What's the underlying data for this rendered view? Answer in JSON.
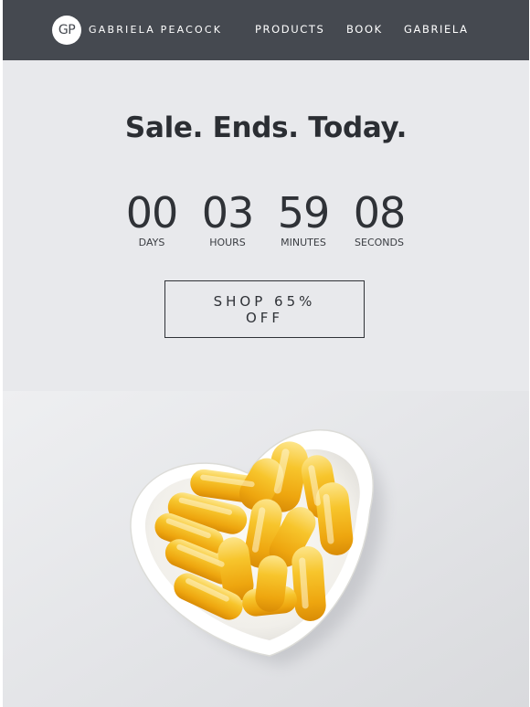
{
  "header": {
    "logo_monogram": "GP",
    "brand_name": "GABRIELA PEACOCK",
    "nav": [
      {
        "label": "PRODUCTS"
      },
      {
        "label": "BOOK"
      },
      {
        "label": "GABRIELA"
      }
    ]
  },
  "main": {
    "headline": "Sale. Ends. Today.",
    "countdown": [
      {
        "value": "00",
        "unit": "DAYS"
      },
      {
        "value": "03",
        "unit": "HOURS"
      },
      {
        "value": "59",
        "unit": "MINUTES"
      },
      {
        "value": "08",
        "unit": "SECONDS"
      }
    ],
    "cta_label": "SHOP 65% OFF"
  },
  "hero": {
    "image": "heart-shaped-bowl-of-fish-oil-capsules"
  },
  "colors": {
    "header_bg": "#454950",
    "page_bg": "#e8e9ec",
    "text_dark": "#2f3237",
    "capsule_gold": "#f2b318"
  }
}
